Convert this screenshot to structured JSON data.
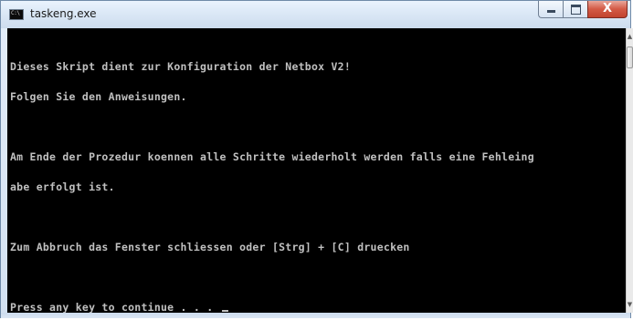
{
  "window": {
    "title": "taskeng.exe",
    "icon": "console-app-icon",
    "icon_text": "C:\\",
    "controls": {
      "minimize": "minimize-icon",
      "maximize": "maximize-icon",
      "close": "close-icon",
      "close_glyph": "X"
    }
  },
  "console": {
    "lines": [
      "Dieses Skript dient zur Konfiguration der Netbox V2!",
      "Folgen Sie den Anweisungen.",
      "",
      "Am Ende der Prozedur koennen alle Schritte wiederholt werden falls eine Fehleing",
      "abe erfolgt ist.",
      "",
      "Zum Abbruch das Fenster schliessen oder [Strg] + [C] druecken",
      "",
      "Press any key to continue . . . "
    ]
  },
  "scrollbar": {
    "up_arrow": "▲",
    "down_arrow": "▼"
  },
  "colors": {
    "console_bg": "#000000",
    "console_text": "#c0c0c0",
    "close_button": "#c94a35"
  }
}
